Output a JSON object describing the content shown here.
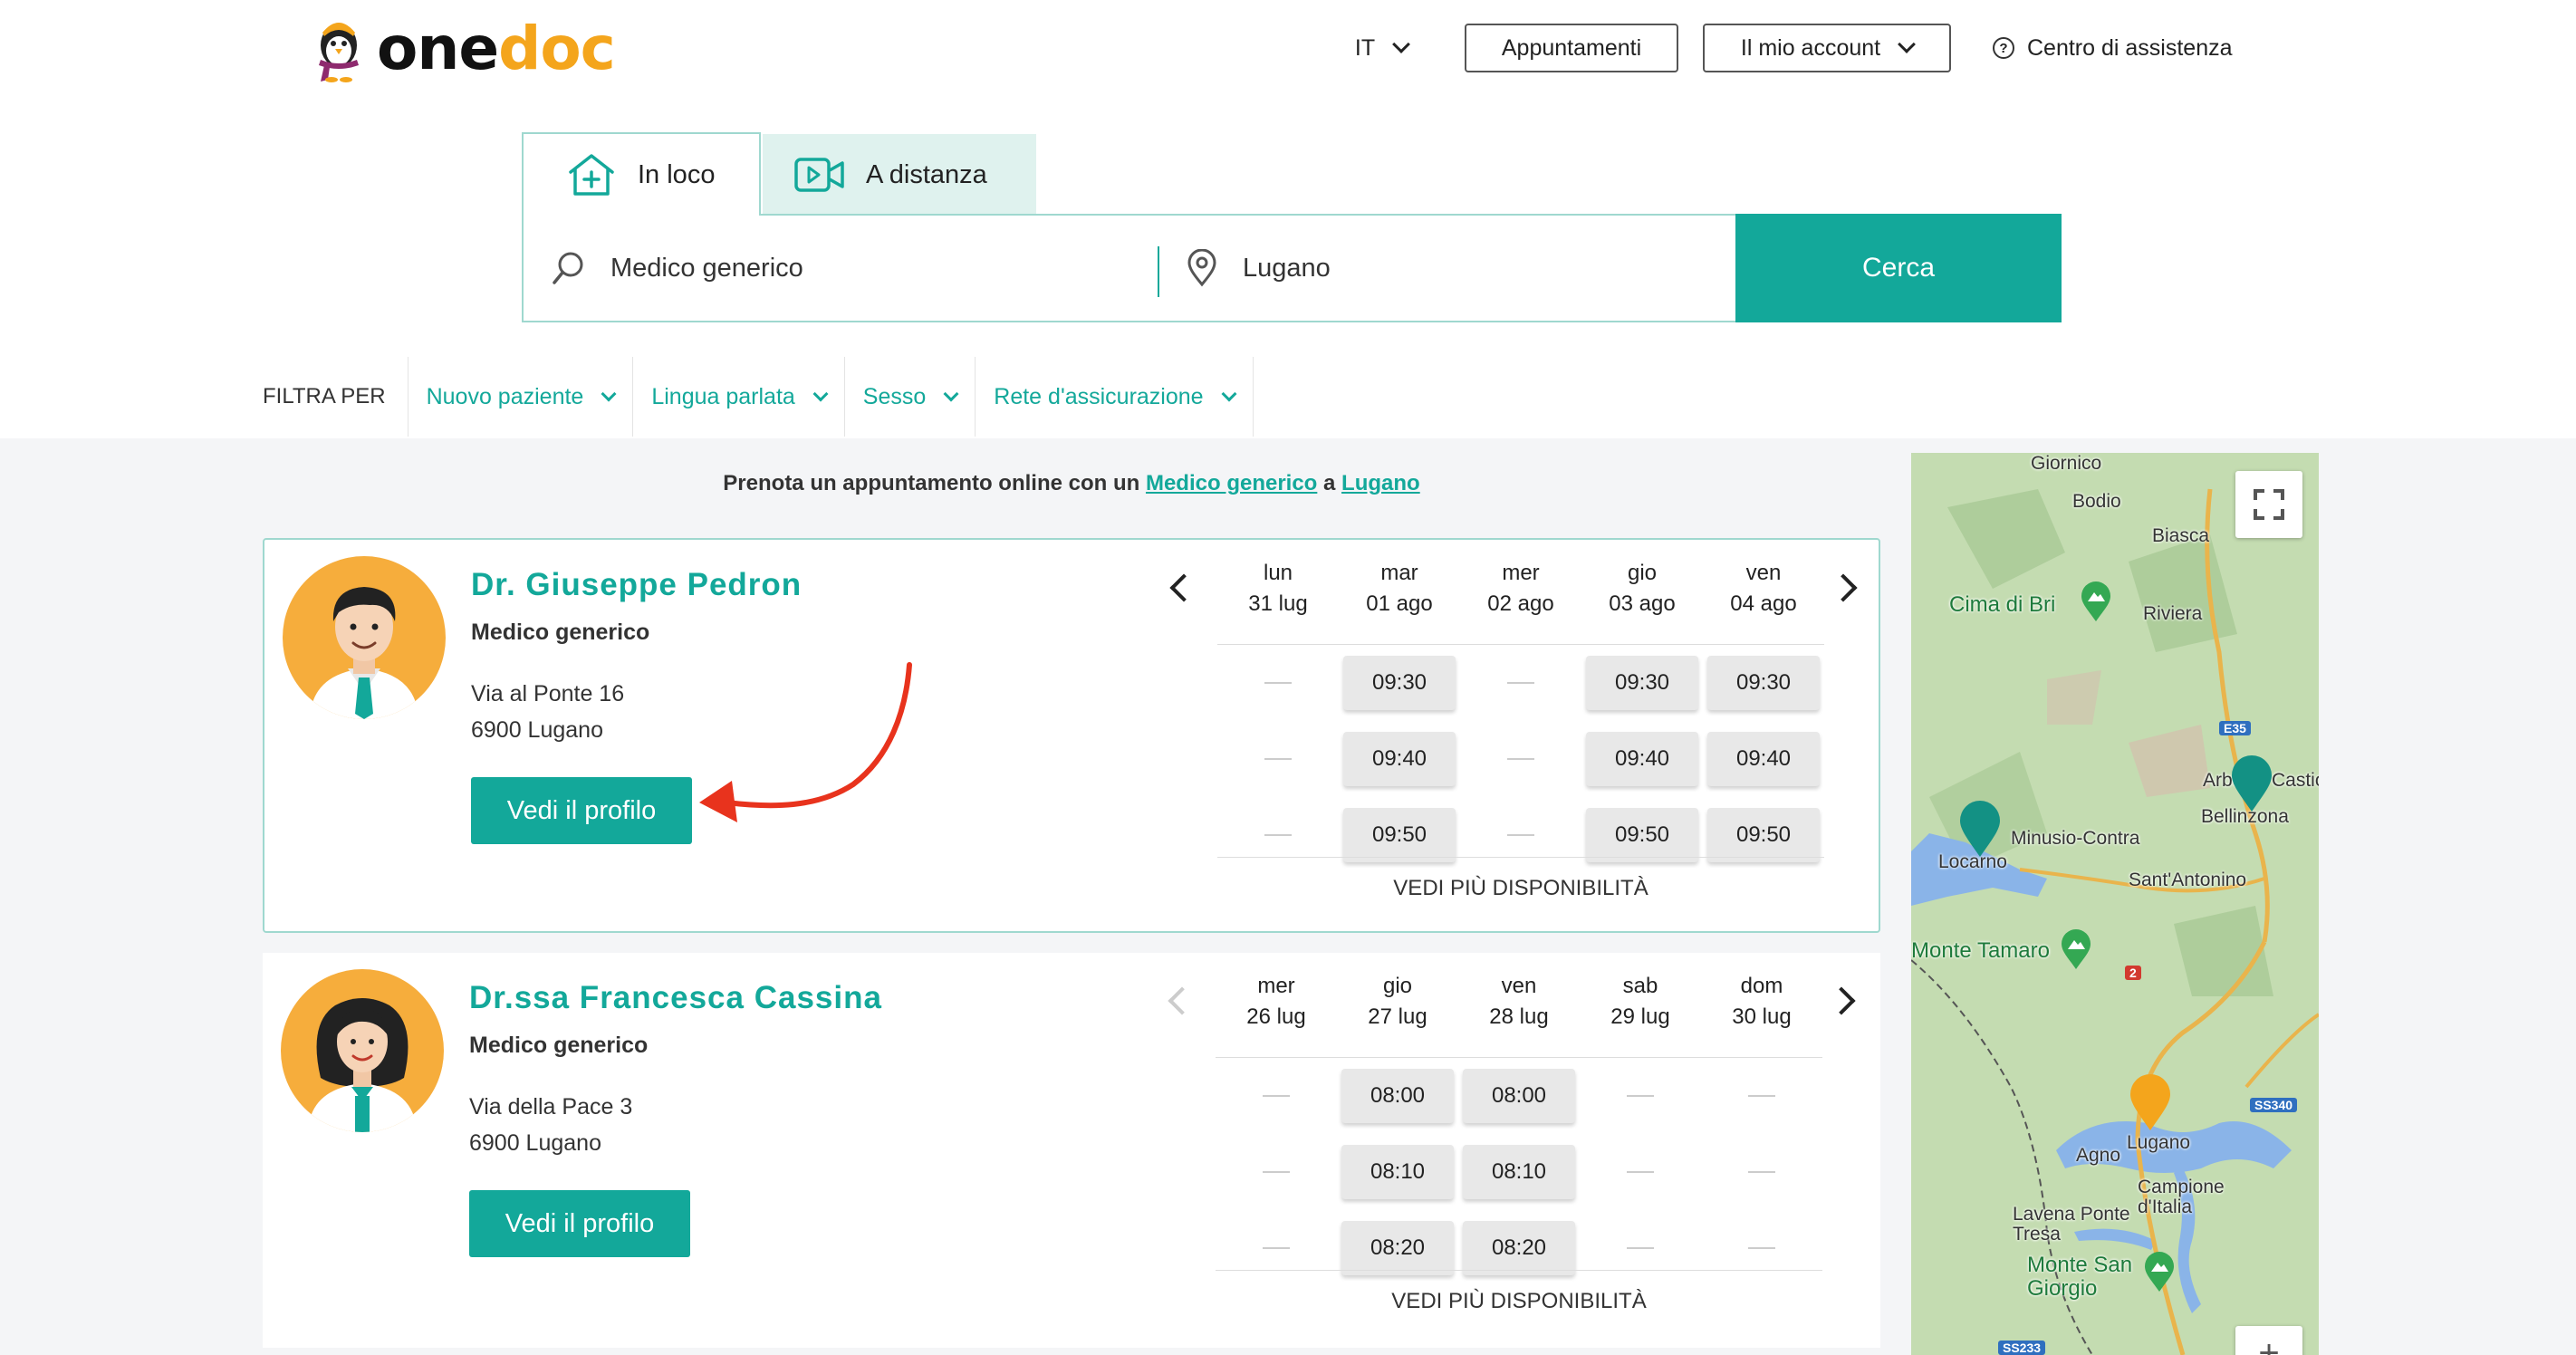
{
  "brand": {
    "part1": "one",
    "part2": "doc"
  },
  "header": {
    "language": "IT",
    "appointments": "Appuntamenti",
    "account": "Il mio account",
    "help": "Centro di assistenza"
  },
  "search": {
    "tabs": [
      {
        "label": "In loco"
      },
      {
        "label": "A distanza"
      }
    ],
    "what": "Medico generico",
    "where": "Lugano",
    "submit": "Cerca"
  },
  "filters": {
    "label": "FILTRA PER",
    "items": [
      "Nuovo paziente",
      "Lingua parlata",
      "Sesso",
      "Rete d'assicurazione"
    ]
  },
  "intro": {
    "prefix": "Prenota un appuntamento online con un",
    "specialty": "Medico generico",
    "joiner": "a",
    "city": "Lugano"
  },
  "doctors": [
    {
      "name": "Dr. Giuseppe Pedron",
      "specialty": "Medico generico",
      "address1": "Via al Ponte 16",
      "address2": "6900 Lugano",
      "profile_button": "Vedi il profilo",
      "days": [
        {
          "dow": "lun",
          "date": "31 lug"
        },
        {
          "dow": "mar",
          "date": "01 ago"
        },
        {
          "dow": "mer",
          "date": "02 ago"
        },
        {
          "dow": "gio",
          "date": "03 ago"
        },
        {
          "dow": "ven",
          "date": "04 ago"
        }
      ],
      "slots": [
        [
          "",
          "09:30",
          "",
          "09:30",
          "09:30"
        ],
        [
          "",
          "09:40",
          "",
          "09:40",
          "09:40"
        ],
        [
          "",
          "09:50",
          "",
          "09:50",
          "09:50"
        ]
      ],
      "more": "VEDI PIÙ DISPONIBILITÀ"
    },
    {
      "name": "Dr.ssa Francesca Cassina",
      "specialty": "Medico generico",
      "address1": "Via della Pace 3",
      "address2": "6900 Lugano",
      "profile_button": "Vedi il profilo",
      "days": [
        {
          "dow": "mer",
          "date": "26 lug"
        },
        {
          "dow": "gio",
          "date": "27 lug"
        },
        {
          "dow": "ven",
          "date": "28 lug"
        },
        {
          "dow": "sab",
          "date": "29 lug"
        },
        {
          "dow": "dom",
          "date": "30 lug"
        }
      ],
      "slots": [
        [
          "",
          "08:00",
          "08:00",
          "",
          ""
        ],
        [
          "",
          "08:10",
          "08:10",
          "",
          ""
        ],
        [
          "",
          "08:20",
          "08:20",
          "",
          ""
        ]
      ],
      "more": "VEDI PIÙ DISPONIBILITÀ"
    }
  ],
  "map": {
    "places": [
      "Giornico",
      "Bodio",
      "Biasca",
      "Cima di Bri",
      "Riviera",
      "Arbedo",
      "Castione",
      "Bellinzona",
      "Locarno",
      "Minusio-Contra",
      "Sant'Antonino",
      "Monte Tamaro",
      "Lugano",
      "Agno",
      "Campione d'Italia",
      "Lavena Ponte Tresa",
      "Monte San Giorgio"
    ],
    "roads": [
      "E35",
      "2",
      "SS340",
      "SS233"
    ]
  },
  "colors": {
    "primary": "#13a89a",
    "accent": "#f4a51c",
    "annotation": "#e8331d"
  }
}
